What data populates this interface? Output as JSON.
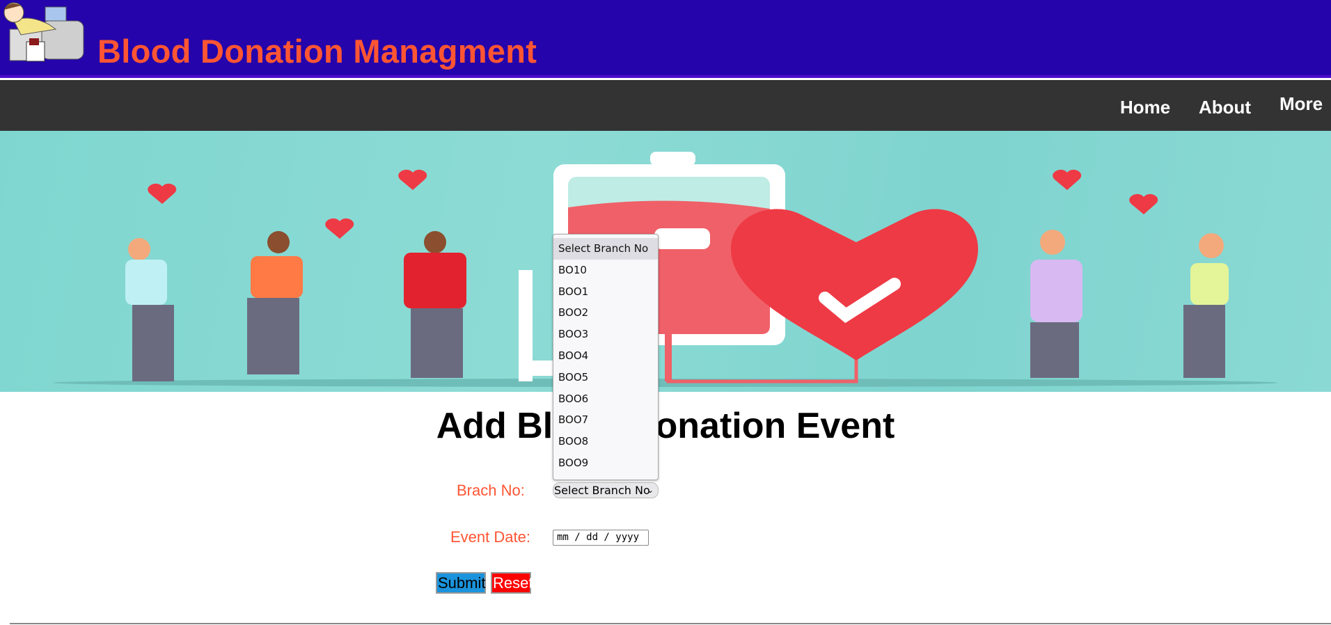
{
  "header": {
    "title": "Blood Donation Managment"
  },
  "nav": {
    "items": [
      {
        "label": "Home"
      },
      {
        "label": "About"
      },
      {
        "label": "More"
      }
    ]
  },
  "page": {
    "heading": "Add Blood Donation Event"
  },
  "form": {
    "branch_label": "Brach No:",
    "branch_selected": "Select Branch No",
    "branch_options": [
      "Select Branch No",
      "BO10",
      "BOO1",
      "BOO2",
      "BOO3",
      "BOO4",
      "BOO5",
      "BOO6",
      "BOO7",
      "BOO8",
      "BOO9"
    ],
    "date_label": "Event Date:",
    "date_placeholder": "mm / dd / yyyy",
    "submit_label": "Submit",
    "reset_label": "Reset"
  },
  "colors": {
    "header_bg": "#2505ab",
    "title": "#ff5533",
    "nav_bg": "#333333",
    "submit_bg": "#1b93dc",
    "reset_bg": "#ff0000"
  }
}
